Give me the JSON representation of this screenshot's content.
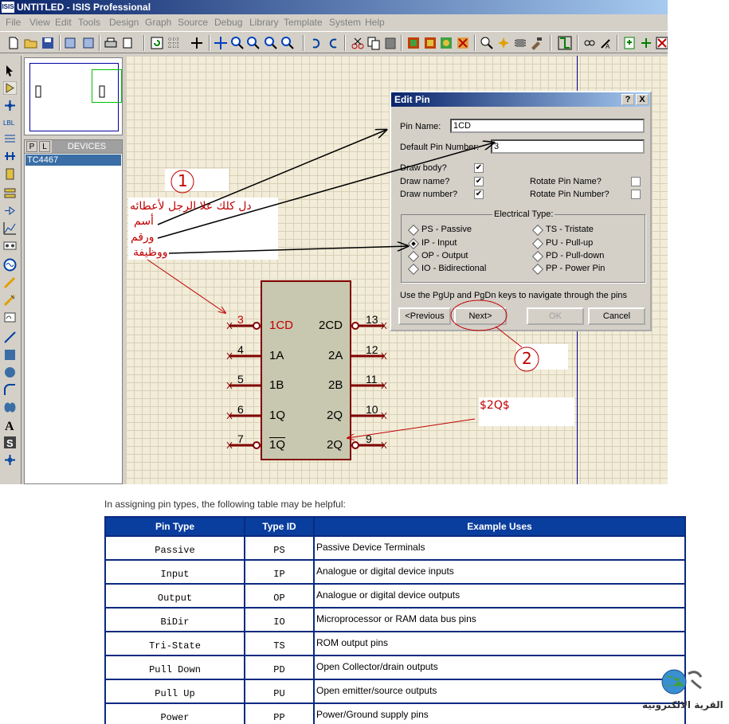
{
  "window": {
    "title": "UNTITLED - ISIS Professional",
    "app_icon": "ISIS"
  },
  "menu": [
    "File",
    "View",
    "Edit",
    "Tools",
    "Design",
    "Graph",
    "Source",
    "Debug",
    "Library",
    "Template",
    "System",
    "Help"
  ],
  "device_panel": {
    "tab_p": "P",
    "tab_l": "L",
    "header": "DEVICES",
    "selected_device": "TC4467"
  },
  "chip": {
    "left_pins": [
      {
        "num": "3",
        "label": "1CD"
      },
      {
        "num": "4",
        "label": "1A"
      },
      {
        "num": "5",
        "label": "1B"
      },
      {
        "num": "6",
        "label": "1Q"
      },
      {
        "num": "7",
        "label": "1Q"
      }
    ],
    "right_pins": [
      {
        "num": "13",
        "label": "2CD"
      },
      {
        "num": "12",
        "label": "2A"
      },
      {
        "num": "11",
        "label": "2B"
      },
      {
        "num": "10",
        "label": "2Q"
      },
      {
        "num": "9",
        "label": "2Q"
      }
    ]
  },
  "dialog": {
    "title": "Edit Pin",
    "help_btn": "?",
    "close_btn": "X",
    "pin_name_label": "Pin Name:",
    "pin_name_value": "1CD",
    "pin_number_label": "Default Pin Number:",
    "pin_number_value": "3",
    "draw_body_label": "Draw body?",
    "draw_name_label": "Draw name?",
    "draw_number_label": "Draw number?",
    "rotate_name_label": "Rotate Pin Name?",
    "rotate_number_label": "Rotate Pin Number?",
    "checked_mark": "✔",
    "draw_body": true,
    "draw_name": true,
    "draw_number": true,
    "rotate_name": false,
    "rotate_number": false,
    "electrical_type_label": "Electrical Type:",
    "types_left": [
      "PS - Passive",
      "IP - Input",
      "OP - Output",
      "IO - Bidirectional"
    ],
    "types_right": [
      "TS - Tristate",
      "PU - Pull-up",
      "PD - Pull-down",
      "PP - Power Pin"
    ],
    "selected_type": "IP - Input",
    "hint": "Use the PgUp and PgDn keys to navigate through the pins",
    "btn_previous": "<Previous",
    "btn_next": "Next>",
    "btn_ok": "OK",
    "btn_cancel": "Cancel"
  },
  "annotations": {
    "step1": "1",
    "step2": "2",
    "instruction_line1": "دل كلك علا الرجل لأعطائه",
    "instruction_line2": "أسم",
    "instruction_line3": "ورقم",
    "instruction_line4": "ووظيفة",
    "label_2q": "$2Q$",
    "accent_red": "#c00000"
  },
  "doc": {
    "intro": "In assigning pin types, the following table may be helpful:",
    "columns": [
      "Pin Type",
      "Type ID",
      "Example Uses"
    ],
    "rows": [
      [
        "Passive",
        "PS",
        "Passive Device Terminals"
      ],
      [
        "Input",
        "IP",
        "Analogue or digital device inputs"
      ],
      [
        "Output",
        "OP",
        "Analogue or digital device outputs"
      ],
      [
        "BiDir",
        "IO",
        "Microprocessor or RAM data bus pins"
      ],
      [
        "Tri-State",
        "TS",
        "ROM output pins"
      ],
      [
        "Pull Down",
        "PD",
        "Open Collector/drain outputs"
      ],
      [
        "Pull Up",
        "PU",
        "Open emitter/source outputs"
      ],
      [
        "Power",
        "PP",
        "Power/Ground supply pins"
      ]
    ]
  },
  "logo_text": "القرية الالكترونية"
}
